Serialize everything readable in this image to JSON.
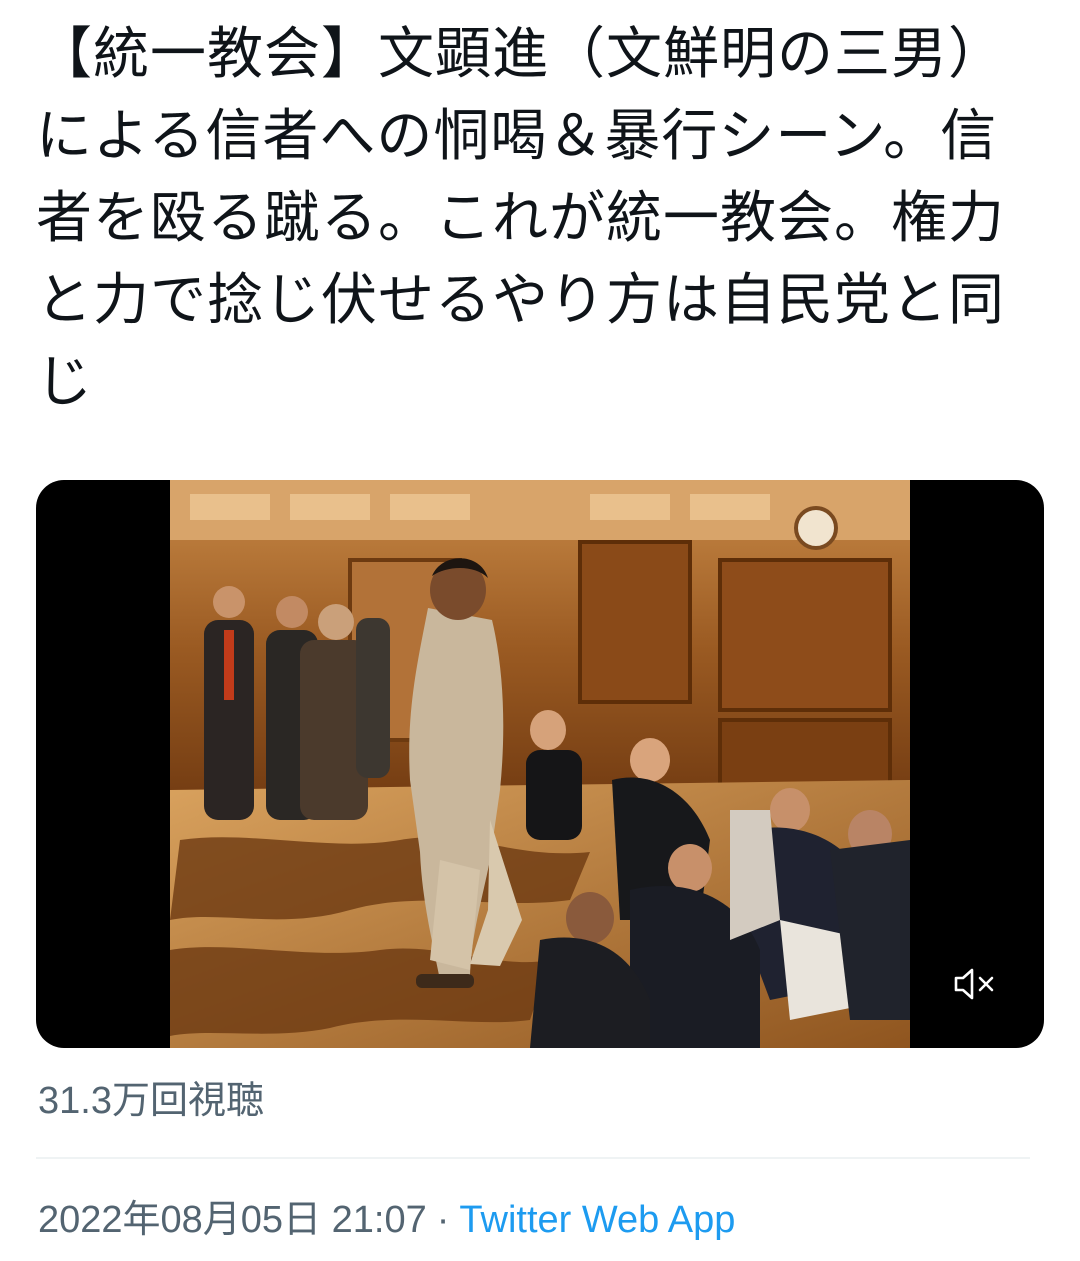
{
  "tweet": {
    "text": "【統一教会】文顕進（文鮮明の三男）による信者への恫喝＆暴行シーン。信者を殴る蹴る。これが統一教会。権力と力で捻じ伏せるやり方は自民党と同じ",
    "view_count": "31.3万回視聴",
    "timestamp": "2022年08月05日 21:07",
    "separator": "·",
    "source": "Twitter Web App"
  },
  "video": {
    "mute_icon": "speaker-muted-icon",
    "muted": true
  },
  "colors": {
    "text": "#0f1419",
    "secondary": "#536471",
    "link": "#1d9bf0",
    "divider": "#eff3f4",
    "video_bg": "#000000"
  }
}
